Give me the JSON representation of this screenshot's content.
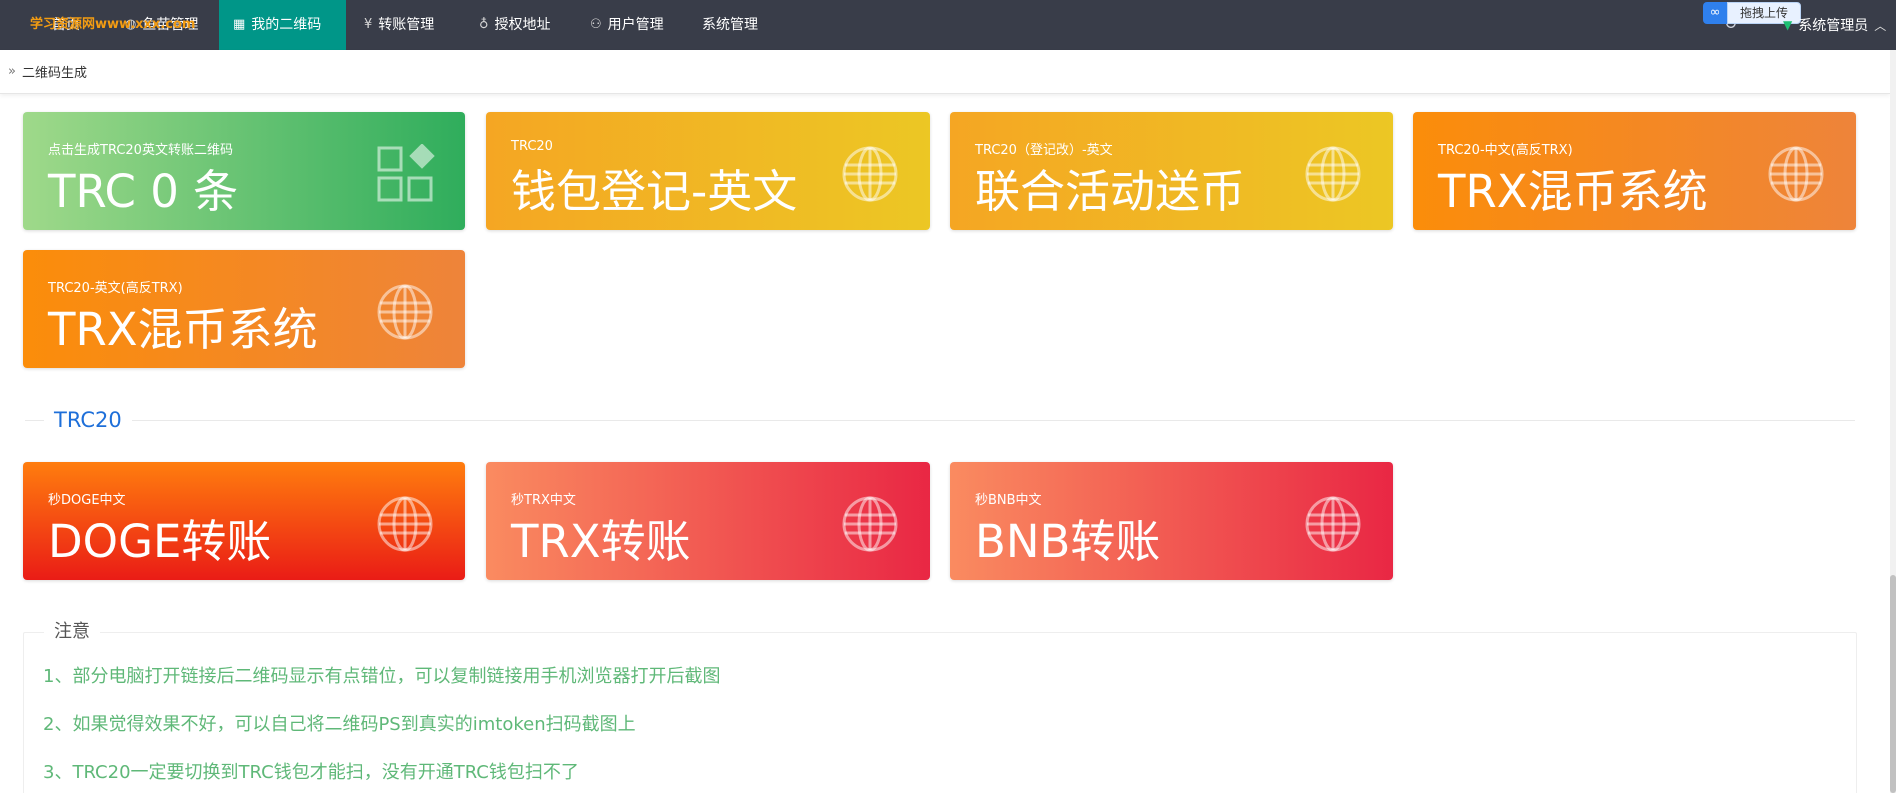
{
  "nav": {
    "watermark": "学习资源网www.xxx.com",
    "items": [
      {
        "label": "首页",
        "icon": "home-icon"
      },
      {
        "label": "鱼苗管理",
        "icon": "globe-icon"
      },
      {
        "label": "我的二维码",
        "icon": "qrcode-icon",
        "active": true
      },
      {
        "label": "转账管理",
        "icon": "yen-icon"
      },
      {
        "label": "授权地址",
        "icon": "bulb-icon"
      },
      {
        "label": "用户管理",
        "icon": "user-icon"
      },
      {
        "label": "系统管理",
        "icon": ""
      }
    ],
    "upload_label": "拖拽上传",
    "user_label": "系统管理员",
    "active_color": "#009688",
    "bar_color": "#393D49"
  },
  "breadcrumb": {
    "label": "二维码生成"
  },
  "cards_row1": [
    {
      "sub": "点击生成TRC20英文转账二维码",
      "big": "TRC 0 条",
      "icon": "apps-icon",
      "style": "green"
    },
    {
      "sub": "TRC20",
      "big": "钱包登记-英文",
      "icon": "globe-icon",
      "style": "yellow"
    },
    {
      "sub": "TRC20（登记改）-英文",
      "big": "联合活动送币",
      "icon": "globe-icon",
      "style": "yellow"
    },
    {
      "sub": "TRC20-中文(高反TRX)",
      "big": "TRX混币系统",
      "icon": "globe-icon",
      "style": "orange"
    }
  ],
  "cards_row2": [
    {
      "sub": "TRC20-英文(高反TRX)",
      "big": "TRX混币系统",
      "icon": "globe-icon",
      "style": "orange"
    }
  ],
  "section": {
    "title": "TRC20"
  },
  "cards_row3": [
    {
      "sub": "秒DOGE中文",
      "big": "DOGE转账",
      "icon": "globe-icon",
      "style": "redorange"
    },
    {
      "sub": "秒TRX中文",
      "big": "TRX转账",
      "icon": "globe-icon",
      "style": "salmon"
    },
    {
      "sub": "秒BNB中文",
      "big": "BNB转账",
      "icon": "globe-icon",
      "style": "salmon"
    }
  ],
  "notice": {
    "legend": "注意",
    "lines": [
      "1、部分电脑打开链接后二维码显示有点错位，可以复制链接用手机浏览器打开后截图",
      "2、如果觉得效果不好，可以自己将二维码PS到真实的imtoken扫码截图上",
      "3、TRC20一定要切换到TRC钱包才能扫，没有开通TRC钱包扫不了"
    ],
    "color": "#5FB878"
  }
}
